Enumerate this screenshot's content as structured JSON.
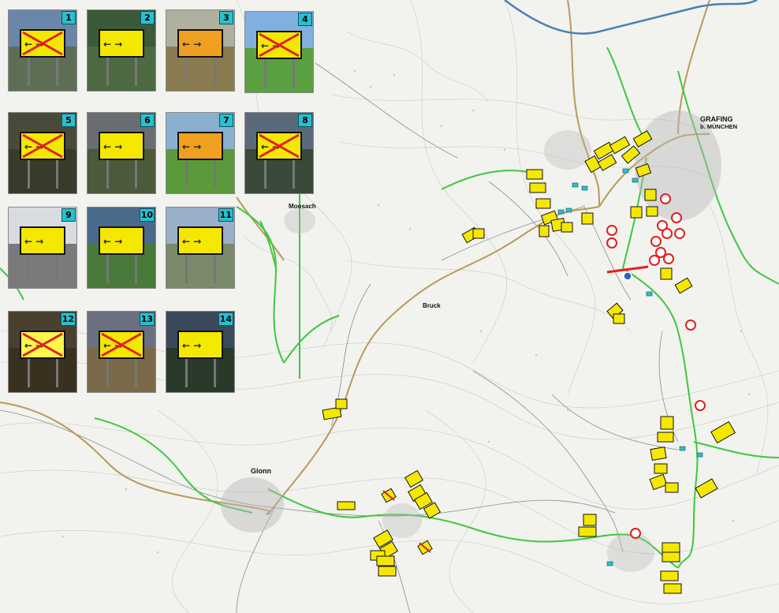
{
  "map": {
    "town_labels": {
      "grafing": "GRAFING",
      "grafing_sub": "b. MÜNCHEN",
      "moosach": "Moosach",
      "glonn": "Glonn",
      "bruck": "Bruck"
    }
  },
  "photos": [
    {
      "number": "1"
    },
    {
      "number": "2"
    },
    {
      "number": "3"
    },
    {
      "number": "4"
    },
    {
      "number": "5"
    },
    {
      "number": "6"
    },
    {
      "number": "7"
    },
    {
      "number": "8"
    },
    {
      "number": "9"
    },
    {
      "number": "10"
    },
    {
      "number": "11"
    },
    {
      "number": "12"
    },
    {
      "number": "13"
    },
    {
      "number": "14"
    }
  ],
  "colors": {
    "sign_yellow": "#f5e800",
    "route_green": "#3ec83e",
    "road_brown": "#b89a5a",
    "river_blue": "#4a7fb5",
    "detour_red": "#e02020",
    "marker_cyan": "#28c0d0"
  }
}
